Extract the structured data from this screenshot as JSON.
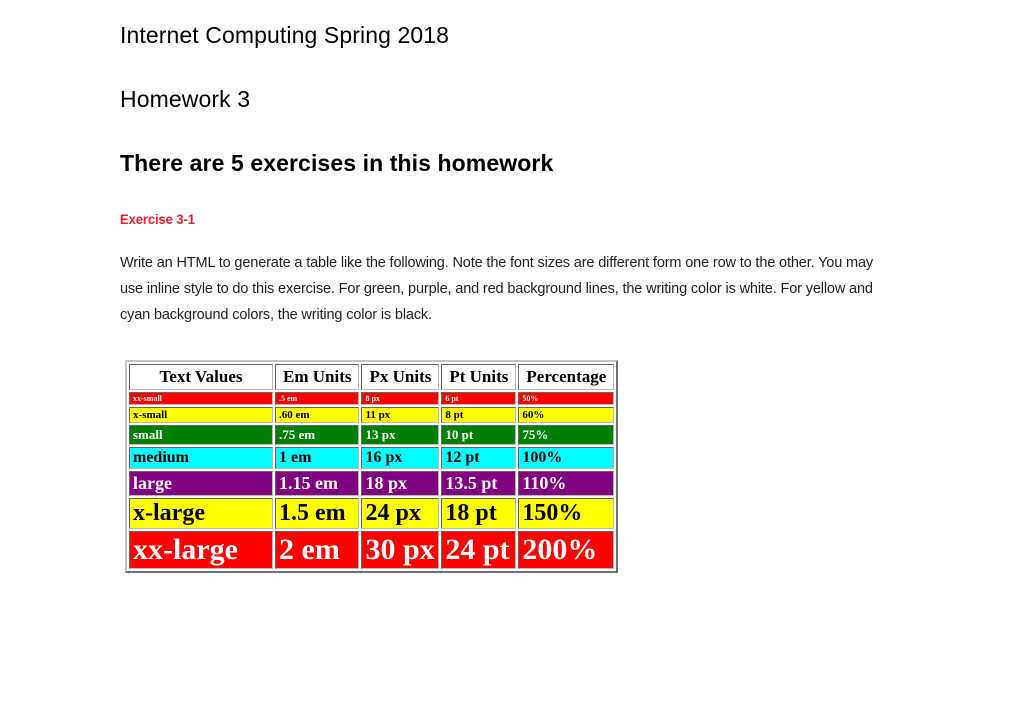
{
  "document": {
    "course_title": "Internet Computing Spring 2018",
    "assignment_title": "Homework 3",
    "exercise_count_text": "There are 5 exercises in this homework",
    "exercise_label": "Exercise 3-1",
    "instructions": "Write an HTML to generate a table like the following. Note the font sizes are different form one row to the other. You may use inline style to do this exercise. For green, purple, and red background lines, the writing color is white. For yellow and cyan background colors, the writing color is black."
  },
  "colors": {
    "exercise_label": "#e8202a",
    "body_text": "#1e2124",
    "red": "#ff0000",
    "yellow": "#ffff00",
    "green": "#008000",
    "cyan": "#00ffff",
    "purple": "#800080",
    "white": "#ffffff",
    "black": "#000000",
    "table_border": "#c4c4c4"
  },
  "table": {
    "headers": [
      "Text Values",
      "Em Units",
      "Px Units",
      "Pt Units",
      "Percentage"
    ],
    "rows": [
      {
        "text_value": "xx-small",
        "em": ".5 em",
        "px": "8 px",
        "pt": "6 pt",
        "percentage": "50%",
        "background": "#ff0000",
        "text_color": "#ffffff",
        "font_size_px": 8
      },
      {
        "text_value": "x-small",
        "em": ".60 em",
        "px": "11 px",
        "pt": "8 pt",
        "percentage": "60%",
        "background": "#ffff00",
        "text_color": "#000000",
        "font_size_px": 11
      },
      {
        "text_value": "small",
        "em": ".75 em",
        "px": "13 px",
        "pt": "10 pt",
        "percentage": "75%",
        "background": "#008000",
        "text_color": "#ffffff",
        "font_size_px": 13
      },
      {
        "text_value": "medium",
        "em": "1 em",
        "px": "16 px",
        "pt": "12 pt",
        "percentage": "100%",
        "background": "#00ffff",
        "text_color": "#000000",
        "font_size_px": 16
      },
      {
        "text_value": "large",
        "em": "1.15 em",
        "px": "18 px",
        "pt": "13.5 pt",
        "percentage": "110%",
        "background": "#800080",
        "text_color": "#ffffff",
        "font_size_px": 18
      },
      {
        "text_value": "x-large",
        "em": "1.5 em",
        "px": "24 px",
        "pt": "18 pt",
        "percentage": "150%",
        "background": "#ffff00",
        "text_color": "#000000",
        "font_size_px": 24
      },
      {
        "text_value": "xx-large",
        "em": "2 em",
        "px": "30 px",
        "pt": "24 pt",
        "percentage": "200%",
        "background": "#ff0000",
        "text_color": "#ffffff",
        "font_size_px": 30
      }
    ]
  }
}
